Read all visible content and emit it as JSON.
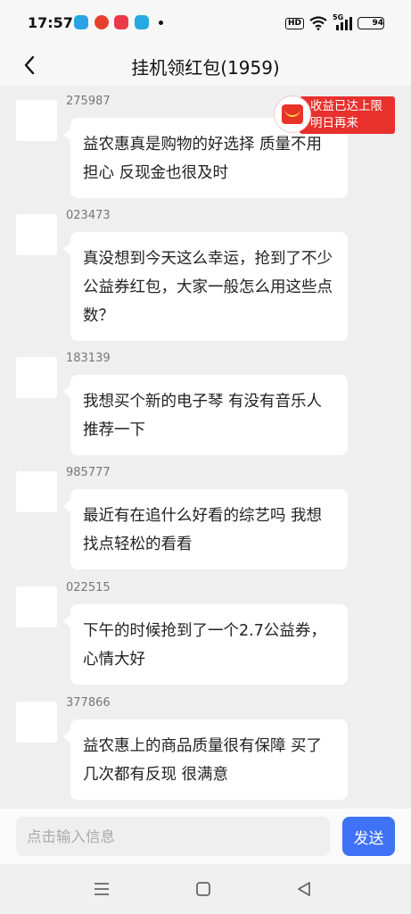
{
  "status": {
    "time": "17:57",
    "hd": "HD",
    "signal_label": "5G",
    "battery": "94",
    "battery_level": 0.94
  },
  "nav": {
    "title": "挂机领红包(1959)"
  },
  "reward": {
    "line1": "收益已达上限",
    "line2": "明日再来"
  },
  "messages": [
    {
      "user": "275987",
      "text": "益农惠真是购物的好选择 质量不用担心 反现金也很及时"
    },
    {
      "user": "023473",
      "text": "真没想到今天这么幸运，抢到了不少公益券红包，大家一般怎么用这些点数？"
    },
    {
      "user": "183139",
      "text": "我想买个新的电子琴 有没有音乐人推荐一下"
    },
    {
      "user": "985777",
      "text": "最近有在追什么好看的综艺吗 我想找点轻松的看看"
    },
    {
      "user": "022515",
      "text": "下午的时候抢到了一个2.7公益券，心情大好"
    },
    {
      "user": "377866",
      "text": "益农惠上的商品质量很有保障 买了几次都有反现 很满意"
    }
  ],
  "input": {
    "placeholder": "点击输入信息",
    "value": ""
  },
  "send": {
    "label": "发送"
  },
  "colors": {
    "accent": "#3f72f6",
    "reward_red": "#e8302d"
  }
}
